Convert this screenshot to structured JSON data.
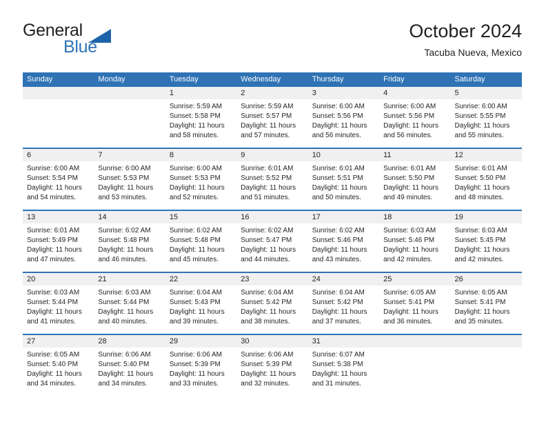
{
  "brand": {
    "word_one": "General",
    "word_two": "Blue",
    "triangle_icon": "brand-triangle-icon",
    "accent_color": "#2f73b5"
  },
  "header": {
    "title": "October 2024",
    "subtitle": "Tacuba Nueva, Mexico"
  },
  "colors": {
    "header_blue": "#2f73b5",
    "day_band_gray": "#f0f0f0",
    "text": "#231f20"
  },
  "calendar": {
    "weekday_headers": [
      "Sunday",
      "Monday",
      "Tuesday",
      "Wednesday",
      "Thursday",
      "Friday",
      "Saturday"
    ],
    "weeks": [
      [
        {
          "day": "",
          "empty": true
        },
        {
          "day": "",
          "empty": true
        },
        {
          "day": "1",
          "sunrise": "Sunrise: 5:59 AM",
          "sunset": "Sunset: 5:58 PM",
          "daylight_1": "Daylight: 11 hours",
          "daylight_2": "and 58 minutes."
        },
        {
          "day": "2",
          "sunrise": "Sunrise: 5:59 AM",
          "sunset": "Sunset: 5:57 PM",
          "daylight_1": "Daylight: 11 hours",
          "daylight_2": "and 57 minutes."
        },
        {
          "day": "3",
          "sunrise": "Sunrise: 6:00 AM",
          "sunset": "Sunset: 5:56 PM",
          "daylight_1": "Daylight: 11 hours",
          "daylight_2": "and 56 minutes."
        },
        {
          "day": "4",
          "sunrise": "Sunrise: 6:00 AM",
          "sunset": "Sunset: 5:56 PM",
          "daylight_1": "Daylight: 11 hours",
          "daylight_2": "and 56 minutes."
        },
        {
          "day": "5",
          "sunrise": "Sunrise: 6:00 AM",
          "sunset": "Sunset: 5:55 PM",
          "daylight_1": "Daylight: 11 hours",
          "daylight_2": "and 55 minutes."
        }
      ],
      [
        {
          "day": "6",
          "sunrise": "Sunrise: 6:00 AM",
          "sunset": "Sunset: 5:54 PM",
          "daylight_1": "Daylight: 11 hours",
          "daylight_2": "and 54 minutes."
        },
        {
          "day": "7",
          "sunrise": "Sunrise: 6:00 AM",
          "sunset": "Sunset: 5:53 PM",
          "daylight_1": "Daylight: 11 hours",
          "daylight_2": "and 53 minutes."
        },
        {
          "day": "8",
          "sunrise": "Sunrise: 6:00 AM",
          "sunset": "Sunset: 5:53 PM",
          "daylight_1": "Daylight: 11 hours",
          "daylight_2": "and 52 minutes."
        },
        {
          "day": "9",
          "sunrise": "Sunrise: 6:01 AM",
          "sunset": "Sunset: 5:52 PM",
          "daylight_1": "Daylight: 11 hours",
          "daylight_2": "and 51 minutes."
        },
        {
          "day": "10",
          "sunrise": "Sunrise: 6:01 AM",
          "sunset": "Sunset: 5:51 PM",
          "daylight_1": "Daylight: 11 hours",
          "daylight_2": "and 50 minutes."
        },
        {
          "day": "11",
          "sunrise": "Sunrise: 6:01 AM",
          "sunset": "Sunset: 5:50 PM",
          "daylight_1": "Daylight: 11 hours",
          "daylight_2": "and 49 minutes."
        },
        {
          "day": "12",
          "sunrise": "Sunrise: 6:01 AM",
          "sunset": "Sunset: 5:50 PM",
          "daylight_1": "Daylight: 11 hours",
          "daylight_2": "and 48 minutes."
        }
      ],
      [
        {
          "day": "13",
          "sunrise": "Sunrise: 6:01 AM",
          "sunset": "Sunset: 5:49 PM",
          "daylight_1": "Daylight: 11 hours",
          "daylight_2": "and 47 minutes."
        },
        {
          "day": "14",
          "sunrise": "Sunrise: 6:02 AM",
          "sunset": "Sunset: 5:48 PM",
          "daylight_1": "Daylight: 11 hours",
          "daylight_2": "and 46 minutes."
        },
        {
          "day": "15",
          "sunrise": "Sunrise: 6:02 AM",
          "sunset": "Sunset: 5:48 PM",
          "daylight_1": "Daylight: 11 hours",
          "daylight_2": "and 45 minutes."
        },
        {
          "day": "16",
          "sunrise": "Sunrise: 6:02 AM",
          "sunset": "Sunset: 5:47 PM",
          "daylight_1": "Daylight: 11 hours",
          "daylight_2": "and 44 minutes."
        },
        {
          "day": "17",
          "sunrise": "Sunrise: 6:02 AM",
          "sunset": "Sunset: 5:46 PM",
          "daylight_1": "Daylight: 11 hours",
          "daylight_2": "and 43 minutes."
        },
        {
          "day": "18",
          "sunrise": "Sunrise: 6:03 AM",
          "sunset": "Sunset: 5:46 PM",
          "daylight_1": "Daylight: 11 hours",
          "daylight_2": "and 42 minutes."
        },
        {
          "day": "19",
          "sunrise": "Sunrise: 6:03 AM",
          "sunset": "Sunset: 5:45 PM",
          "daylight_1": "Daylight: 11 hours",
          "daylight_2": "and 42 minutes."
        }
      ],
      [
        {
          "day": "20",
          "sunrise": "Sunrise: 6:03 AM",
          "sunset": "Sunset: 5:44 PM",
          "daylight_1": "Daylight: 11 hours",
          "daylight_2": "and 41 minutes."
        },
        {
          "day": "21",
          "sunrise": "Sunrise: 6:03 AM",
          "sunset": "Sunset: 5:44 PM",
          "daylight_1": "Daylight: 11 hours",
          "daylight_2": "and 40 minutes."
        },
        {
          "day": "22",
          "sunrise": "Sunrise: 6:04 AM",
          "sunset": "Sunset: 5:43 PM",
          "daylight_1": "Daylight: 11 hours",
          "daylight_2": "and 39 minutes."
        },
        {
          "day": "23",
          "sunrise": "Sunrise: 6:04 AM",
          "sunset": "Sunset: 5:42 PM",
          "daylight_1": "Daylight: 11 hours",
          "daylight_2": "and 38 minutes."
        },
        {
          "day": "24",
          "sunrise": "Sunrise: 6:04 AM",
          "sunset": "Sunset: 5:42 PM",
          "daylight_1": "Daylight: 11 hours",
          "daylight_2": "and 37 minutes."
        },
        {
          "day": "25",
          "sunrise": "Sunrise: 6:05 AM",
          "sunset": "Sunset: 5:41 PM",
          "daylight_1": "Daylight: 11 hours",
          "daylight_2": "and 36 minutes."
        },
        {
          "day": "26",
          "sunrise": "Sunrise: 6:05 AM",
          "sunset": "Sunset: 5:41 PM",
          "daylight_1": "Daylight: 11 hours",
          "daylight_2": "and 35 minutes."
        }
      ],
      [
        {
          "day": "27",
          "sunrise": "Sunrise: 6:05 AM",
          "sunset": "Sunset: 5:40 PM",
          "daylight_1": "Daylight: 11 hours",
          "daylight_2": "and 34 minutes."
        },
        {
          "day": "28",
          "sunrise": "Sunrise: 6:06 AM",
          "sunset": "Sunset: 5:40 PM",
          "daylight_1": "Daylight: 11 hours",
          "daylight_2": "and 34 minutes."
        },
        {
          "day": "29",
          "sunrise": "Sunrise: 6:06 AM",
          "sunset": "Sunset: 5:39 PM",
          "daylight_1": "Daylight: 11 hours",
          "daylight_2": "and 33 minutes."
        },
        {
          "day": "30",
          "sunrise": "Sunrise: 6:06 AM",
          "sunset": "Sunset: 5:39 PM",
          "daylight_1": "Daylight: 11 hours",
          "daylight_2": "and 32 minutes."
        },
        {
          "day": "31",
          "sunrise": "Sunrise: 6:07 AM",
          "sunset": "Sunset: 5:38 PM",
          "daylight_1": "Daylight: 11 hours",
          "daylight_2": "and 31 minutes."
        },
        {
          "day": "",
          "empty": true
        },
        {
          "day": "",
          "empty": true
        }
      ]
    ]
  }
}
